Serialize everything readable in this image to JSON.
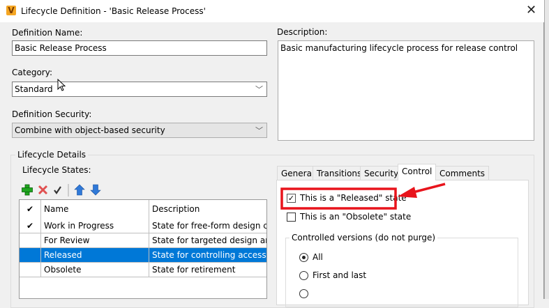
{
  "window": {
    "title": "Lifecycle Definition - 'Basic Release Process'",
    "logo": "V",
    "close_icon": "close-icon"
  },
  "form": {
    "name_label": "Definition Name:",
    "name_value": "Basic Release Process",
    "category_label": "Category:",
    "category_value": "Standard",
    "security_label": "Definition Security:",
    "security_value": "Combine with object-based security",
    "description_label": "Description:",
    "description_value": "Basic manufacturing lifecycle process for release control"
  },
  "details": {
    "group_label": "Lifecycle Details",
    "states_label": "Lifecycle States:",
    "toolbar": [
      "add-icon",
      "delete-icon",
      "set-default-icon",
      "move-up-icon",
      "move-down-icon"
    ],
    "columns": [
      "✔",
      "Name",
      "Description"
    ],
    "rows": [
      {
        "check": "✔",
        "name": "Work in Progress",
        "description": "State for free-form design cr..."
      },
      {
        "check": "",
        "name": "For Review",
        "description": "State for targeted design and..."
      },
      {
        "check": "",
        "name": "Released",
        "description": "State for controlling access a..."
      },
      {
        "check": "",
        "name": "Obsolete",
        "description": "State for retirement"
      }
    ],
    "selected_row": 2
  },
  "tabs": {
    "items": [
      "General",
      "Transitions",
      "Security",
      "Control",
      "Comments"
    ],
    "active": "Control"
  },
  "control": {
    "released_label": "This is a \"Released\" state",
    "released_checked": true,
    "obsolete_label": "This is an \"Obsolete\" state",
    "obsolete_checked": false,
    "versions_label": "Controlled versions (do not purge)",
    "options": [
      "All",
      "First and last"
    ],
    "selected_option": "All"
  },
  "annotation": {
    "color": "#e8141c"
  }
}
